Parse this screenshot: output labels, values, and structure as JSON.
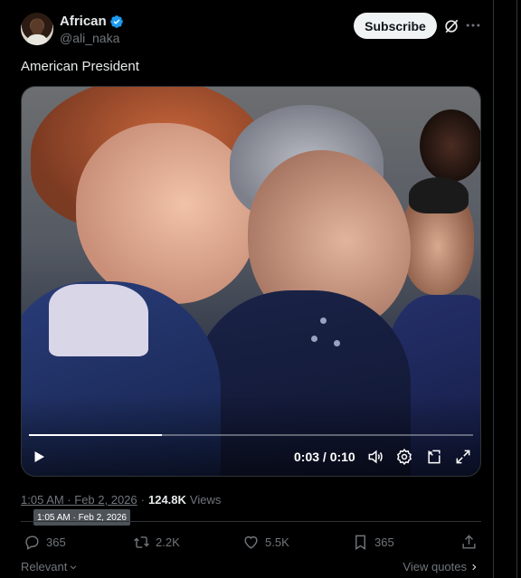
{
  "author": {
    "display_name": "African",
    "handle": "@ali_naka",
    "verified": true
  },
  "header": {
    "subscribe_label": "Subscribe",
    "grok_icon": "grok-icon",
    "more_icon": "more-icon"
  },
  "tweet": {
    "text": "American President"
  },
  "video": {
    "progress": 0.3,
    "time_display": "0:03 / 0:10",
    "icons": [
      "play-icon",
      "volume-icon",
      "settings-icon",
      "picture-in-picture-icon",
      "fullscreen-icon"
    ]
  },
  "meta": {
    "timestamp": "1:05 AM · Feb 2, 2026",
    "views_count": "124.8K",
    "views_label": "Views",
    "tooltip": "1:05 AM · Feb 2, 2026"
  },
  "actions": {
    "replies": "365",
    "reposts": "2.2K",
    "likes": "5.5K",
    "bookmarks": "365"
  },
  "footer": {
    "sort_label": "Relevant",
    "view_quotes_label": "View quotes"
  },
  "colors": {
    "background": "#000000",
    "text_primary": "#e7e9ea",
    "text_secondary": "#71767b",
    "verified_blue": "#1d9bf0",
    "border": "#2f3336"
  }
}
